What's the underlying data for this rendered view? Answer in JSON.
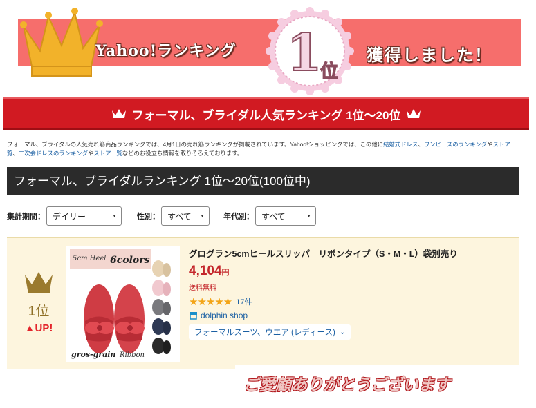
{
  "banner": {
    "left_text": "Yahoo!ランキング",
    "badge_number": "1",
    "badge_suffix": "位",
    "right_text": "獲得しました！",
    "color": "#f66e6c"
  },
  "ranking_title": "フォーマル、ブライダル人気ランキング 1位〜20位",
  "description": {
    "part1": "フォーマル、ブライダルの人気売れ筋商品ランキングでは、4月1日の売れ筋ランキングが掲載されています。Yahoo!ショッピングでは、この他に",
    "link1": "結婚式ドレス",
    "sep1": "、",
    "link2": "ワンピースのランキング",
    "sep2": "や",
    "link3": "ストアー覧",
    "sep3": "、",
    "link4": "二次会ドレスのランキング",
    "sep4": "や",
    "link5": "ストアー覧",
    "part2": "などのお役立ち情報を取りそろえております。"
  },
  "section_header": "フォーマル、ブライダルランキング 1位〜20位(100位中)",
  "filters": {
    "period_label": "集計期間：",
    "period_value": "デイリー",
    "gender_label": "性別：",
    "gender_value": "すべて",
    "age_label": "年代別：",
    "age_value": "すべて"
  },
  "product": {
    "rank": "1位",
    "rank_change": "▲UP!",
    "name": "グログラン5cmヒールスリッパ　リボンタイプ（S・M・L）袋別売り",
    "price": "4,104",
    "price_unit": "円",
    "shipping": "送料無料",
    "rating": 4.5,
    "stars": "★★★★★",
    "review_count": "17件",
    "shop": "dolphin shop",
    "category": "フォーマルスーツ、ウエア (レディース)",
    "photo": {
      "heel_text": "5cm Heel",
      "colors_text": "6colors",
      "bottom_text": "gros-grain",
      "ribbon_text": "Ribbon"
    }
  },
  "thanks_text": "ご愛顧ありがとうございます"
}
